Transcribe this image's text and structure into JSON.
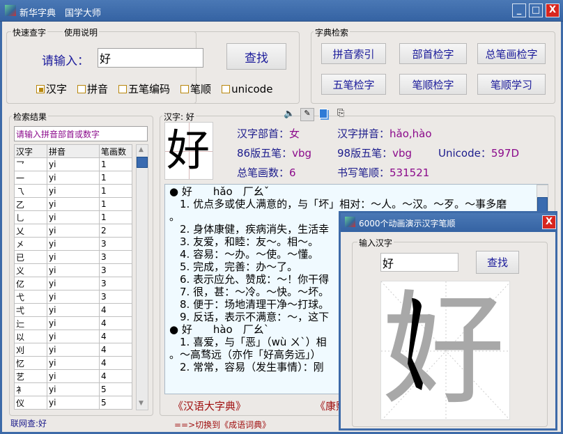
{
  "window": {
    "title": "新华字典　国学大师",
    "min": "_",
    "max": "□",
    "close": "X"
  },
  "quick": {
    "tab1": "快速查字",
    "tab2": "使用说明",
    "input_label": "请输入：",
    "input_value": "好",
    "search": "查找",
    "options": [
      {
        "label": "汉字",
        "checked": true
      },
      {
        "label": "拼音",
        "checked": false
      },
      {
        "label": "五笔编码",
        "checked": false
      },
      {
        "label": "笔顺",
        "checked": false
      },
      {
        "label": "unicode",
        "checked": false
      }
    ]
  },
  "dict": {
    "title": "字典检索",
    "buttons": [
      "拼音索引",
      "部首检字",
      "总笔画检字",
      "五笔检字",
      "笔顺检字",
      "笔顺学习"
    ]
  },
  "results": {
    "title": "检索结果",
    "placeholder": "请输入拼音部首或数字",
    "headers": [
      "汉字",
      "拼音",
      "笔画数"
    ],
    "rows": [
      [
        "乛",
        "yi",
        "1"
      ],
      [
        "一",
        "yi",
        "1"
      ],
      [
        "乁",
        "yi",
        "1"
      ],
      [
        "乙",
        "yi",
        "1"
      ],
      [
        "乚",
        "yi",
        "1"
      ],
      [
        "乂",
        "yi",
        "2"
      ],
      [
        "㐅",
        "yi",
        "3"
      ],
      [
        "已",
        "yi",
        "3"
      ],
      [
        "义",
        "yi",
        "3"
      ],
      [
        "亿",
        "yi",
        "3"
      ],
      [
        "弋",
        "yi",
        "3"
      ],
      [
        "弌",
        "yi",
        "4"
      ],
      [
        "辷",
        "yi",
        "4"
      ],
      [
        "以",
        "yi",
        "4"
      ],
      [
        "刈",
        "yi",
        "4"
      ],
      [
        "忆",
        "yi",
        "4"
      ],
      [
        "艺",
        "yi",
        "4"
      ],
      [
        "衤",
        "yi",
        "5"
      ],
      [
        "仪",
        "yi",
        "5"
      ]
    ],
    "footer": "联网查:好"
  },
  "detail": {
    "title": "汉字: 好",
    "char": "好",
    "info": [
      {
        "label": "汉字部首：",
        "value": "女"
      },
      {
        "label": "汉字拼音：",
        "value": "hǎo,hào"
      },
      {
        "label": "86版五笔：",
        "value": "vbg"
      },
      {
        "label": "98版五笔：",
        "value": "vbg"
      },
      {
        "label": "Unicode：",
        "value": "597D"
      },
      {
        "label": "总笔画数：",
        "value": "6"
      },
      {
        "label": "书写笔顺：",
        "value": "531521"
      }
    ],
    "lines": [
      "● 好　　hǎo　厂幺ˇ",
      "　1. 优点多或使人满意的，与「坏」相对：～人。～汉。～歹。～事多磨",
      "。",
      "　2. 身体康健，疾病消失，生活幸",
      "　3. 友爱，和睦：友～。相～。",
      "　4. 容易：～办。～使。～懂。",
      "　5. 完成，完善：办～了。",
      "　6. 表示应允、赞成：～！你干得",
      "　7. 很，甚：～冷。～快。～坏。",
      "　8. 便于：场地清理干净～打球。",
      "　9. 反话，表示不满意：～，这下",
      "● 好　　hào　厂幺ˋ",
      "　1. 喜爱，与「恶」（wù ㄨˋ）相",
      "。～高骛远（亦作「好高务远」）",
      "　2. 常常，容易（发生事情）：刚"
    ],
    "link1": "《汉语大字典》",
    "link2": "《康熙字典》",
    "switch": "==>切换到《成语词典》"
  },
  "popup": {
    "title": "6000个动画演示汉字笔顺",
    "group": "输入汉字",
    "input_value": "好",
    "search": "查找",
    "char": "好",
    "close": "X"
  }
}
